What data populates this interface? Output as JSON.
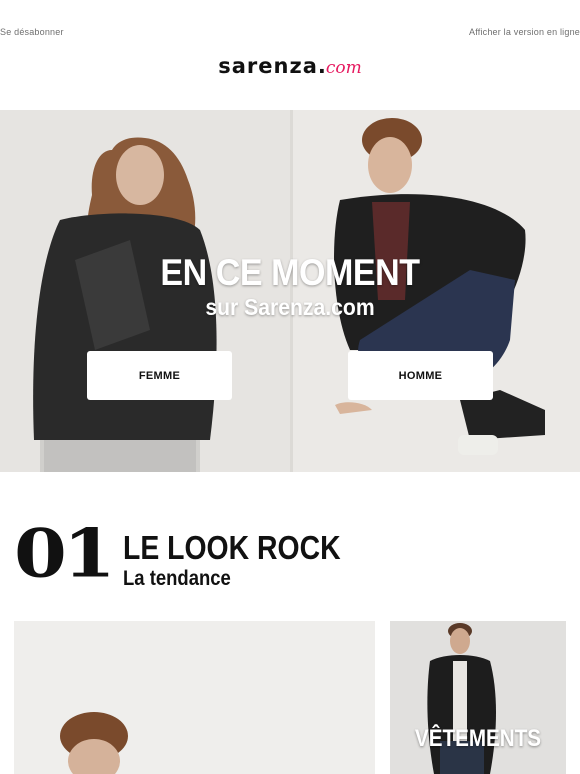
{
  "header": {
    "unsubscribe_label": "Se désabonner",
    "webview_label": "Afficher la version en ligne"
  },
  "logo": {
    "brand": "sarenza",
    "dot": ".",
    "tld": "com",
    "accent_color": "#e6195f"
  },
  "hero": {
    "title": "EN CE MOMENT",
    "subtitle": "sur Sarenza.com",
    "buttons": [
      {
        "label": "FEMME"
      },
      {
        "label": "HOMME"
      }
    ]
  },
  "section": {
    "number": "01",
    "title": "LE LOOK ROCK",
    "subtitle": "La tendance"
  },
  "tiles": {
    "side_label": "VÊTEMENTS"
  }
}
